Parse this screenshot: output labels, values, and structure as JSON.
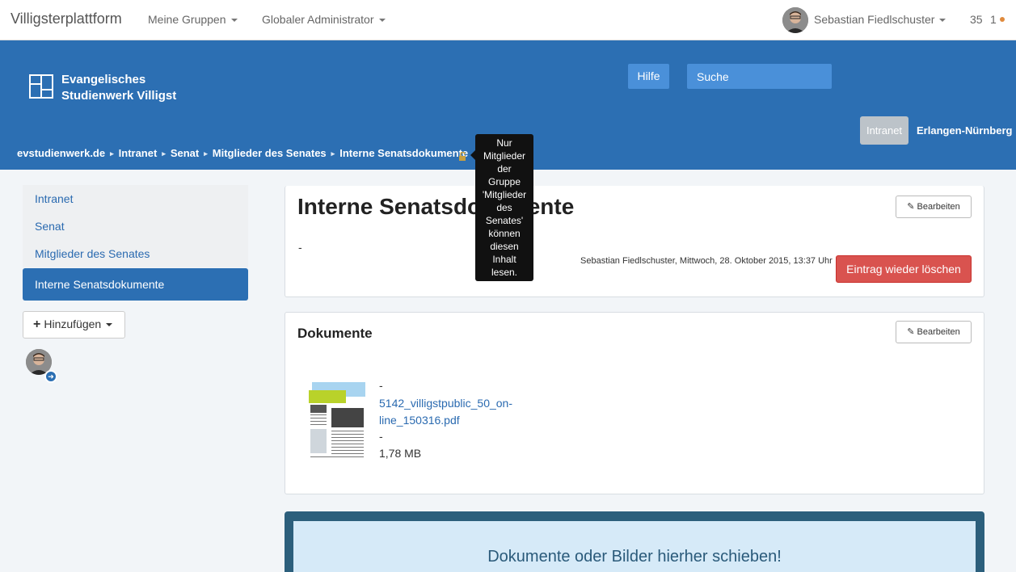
{
  "topbar": {
    "brand": "Villigsterplattform",
    "menus": [
      "Meine Gruppen",
      "Globaler Administrator"
    ],
    "user_name": "Sebastian Fiedlschuster",
    "count_a": "35",
    "count_b": "1"
  },
  "header": {
    "logo_line1": "Evangelisches",
    "logo_line2": "Studienwerk Villigst",
    "help_label": "Hilfe",
    "search_placeholder": "Suche",
    "pills": [
      "Intranet",
      "Erlangen-Nürnberg"
    ],
    "breadcrumb": [
      "evstudienwerk.de",
      "Intranet",
      "Senat",
      "Mitglieder des Senates",
      "Interne Senatsdokumente"
    ]
  },
  "tooltip": {
    "lines": [
      "Nur",
      "Mitglieder",
      "der",
      "Gruppe",
      "'Mitglieder",
      "des",
      "Senates'",
      "können",
      "diesen",
      "Inhalt",
      "lesen."
    ]
  },
  "sidebar": {
    "items": [
      "Intranet",
      "Senat",
      "Mitglieder des Senates",
      "Interne Senatsdokumente"
    ],
    "add_label": "Hinzufügen"
  },
  "page": {
    "title": "Interne Senatsdokumente",
    "edit_label": "Bearbeiten",
    "body_text": "-",
    "meta": "Sebastian Fiedlschuster, Mittwoch, 28. Oktober 2015, 13:37 Uhr",
    "delete_label": "Eintrag wieder löschen"
  },
  "documents": {
    "title": "Dokumente",
    "edit_label": "Bearbeiten",
    "dash_top": "-",
    "file_name": "5142_villigstpublic_50_on-line_150316.pdf",
    "dash_bottom": "-",
    "file_size": "1,78 MB"
  },
  "dropzone": {
    "text": "Dokumente oder Bilder hierher schieben!"
  },
  "colors": {
    "header_blue": "#2c6fb3",
    "danger": "#d9534f",
    "link": "#2a6ab0"
  }
}
